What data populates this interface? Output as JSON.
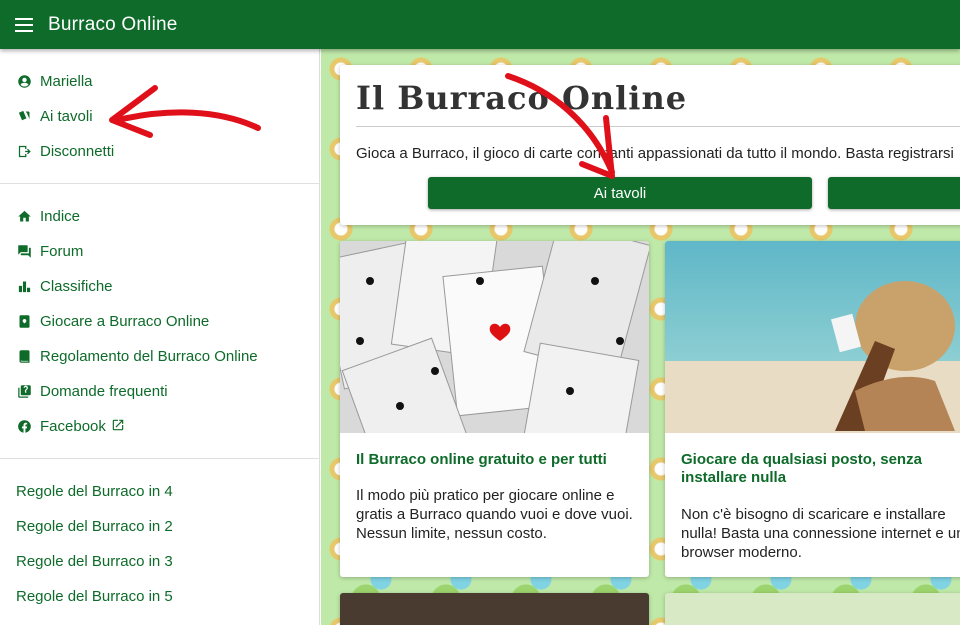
{
  "app": {
    "title": "Burraco Online"
  },
  "sidebar": {
    "user_items": [
      {
        "label": "Mariella",
        "icon": "account-circle-icon"
      },
      {
        "label": "Ai tavoli",
        "icon": "cards-icon"
      },
      {
        "label": "Disconnetti",
        "icon": "logout-icon"
      }
    ],
    "nav_items": [
      {
        "label": "Indice",
        "icon": "home-icon"
      },
      {
        "label": "Forum",
        "icon": "forum-icon"
      },
      {
        "label": "Classifiche",
        "icon": "leaderboard-icon"
      },
      {
        "label": "Giocare a Burraco Online",
        "icon": "card-play-icon"
      },
      {
        "label": "Regolamento del Burraco Online",
        "icon": "book-icon"
      },
      {
        "label": "Domande frequenti",
        "icon": "faq-icon"
      },
      {
        "label": "Facebook",
        "icon": "facebook-icon"
      }
    ],
    "rules_items": [
      {
        "label": "Regole del Burraco in 4"
      },
      {
        "label": "Regole del Burraco in 2"
      },
      {
        "label": "Regole del Burraco in 3"
      },
      {
        "label": "Regole del Burraco in 5"
      }
    ]
  },
  "hero": {
    "title": "Il Burraco Online",
    "text": "Gioca a Burraco, il gioco di carte con tanti appassionati da tutto il mondo. Basta registrarsi",
    "button_primary": "Ai tavoli",
    "button_secondary": ""
  },
  "cards": [
    {
      "title": "Il Burraco online gratuito e per tutti",
      "text": "Il modo più pratico per giocare online e gratis a Burraco quando vuoi e dove vuoi. Nessun limite, nessun costo."
    },
    {
      "title": "Giocare da qualsiasi posto, senza installare nulla",
      "text": "Non c'è bisogno di scaricare e installare nulla! Basta una connessione internet e un browser moderno."
    }
  ],
  "colors": {
    "brand": "#0e6b2a",
    "arrow": "#e0101a"
  }
}
